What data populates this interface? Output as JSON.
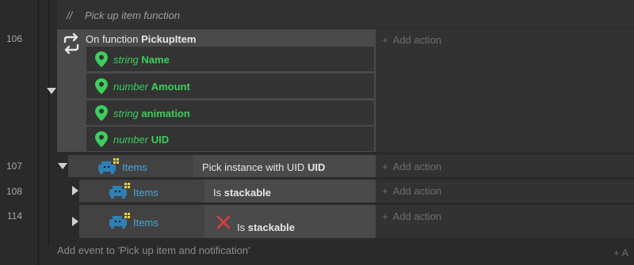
{
  "comment": {
    "marker": "//",
    "text": "Pick up item function"
  },
  "events": [
    {
      "line": "106"
    },
    {
      "line": "107"
    },
    {
      "line": "108"
    },
    {
      "line": "114"
    }
  ],
  "function_event": {
    "prefix": "On function",
    "name": "PickupItem",
    "params": [
      {
        "type": "string",
        "name": "Name"
      },
      {
        "type": "number",
        "name": "Amount"
      },
      {
        "type": "string",
        "name": "animation"
      },
      {
        "type": "number",
        "name": "UID"
      }
    ]
  },
  "sub_events": [
    {
      "object": "Items",
      "condition_text": "Pick instance with UID",
      "condition_bold": "UID",
      "inverted": false
    },
    {
      "object": "Items",
      "condition_text": "Is",
      "condition_bold": "stackable",
      "inverted": false
    },
    {
      "object": "Items",
      "condition_text": "Is",
      "condition_bold": "stackable",
      "inverted": true
    }
  ],
  "add_action_label": "Add action",
  "add_action_plus": "+",
  "add_event_label": "Add event to 'Pick up item and notification'",
  "add_event_right": "+ A",
  "colors": {
    "param_green": "#3ccf5c",
    "object_blue": "#48a8d8",
    "invert_red": "#e03c3c"
  },
  "icons": {
    "function": "repeat-arrows-icon",
    "param": "map-pin-icon",
    "object": "sprite-icon",
    "invert": "x-icon"
  }
}
